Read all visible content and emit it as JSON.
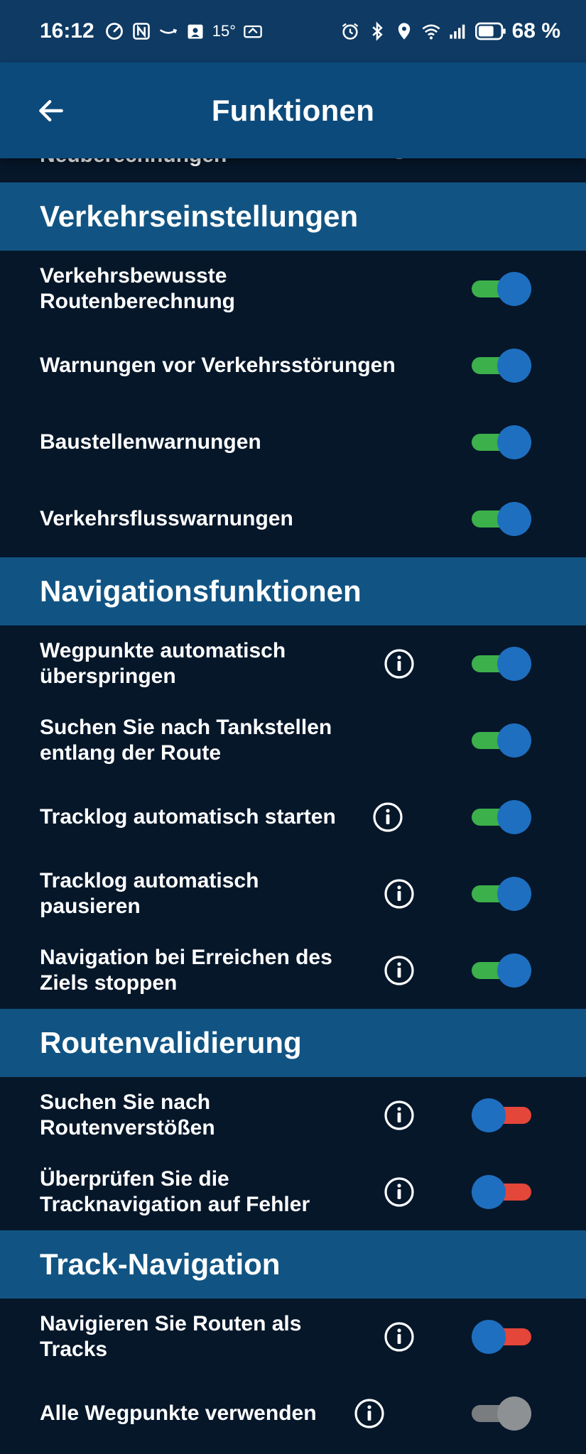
{
  "status_bar": {
    "time": "16:12",
    "temperature": "15°",
    "battery": "68 %",
    "icons_left": [
      "speedometer-icon",
      "nfc-icon",
      "amazon-icon",
      "calendar-person-icon",
      "weather-icon",
      "chat-icon"
    ],
    "icons_right": [
      "alarm-icon",
      "bluetooth-icon",
      "location-icon",
      "wifi-6-icon",
      "signal-icon",
      "battery-icon"
    ]
  },
  "header": {
    "title": "Funktionen",
    "back_icon": "arrow-left-icon"
  },
  "clipped_row": {
    "label": "Neuberechnungen"
  },
  "sections": [
    {
      "title": "Verkehrseinstellungen",
      "items": [
        {
          "label": "Verkehrsbewusste Routenberechnung",
          "info": false,
          "state": "on"
        },
        {
          "label": "Warnungen vor Verkehrsstörungen",
          "info": false,
          "state": "on"
        },
        {
          "label": "Baustellenwarnungen",
          "info": false,
          "state": "on"
        },
        {
          "label": "Verkehrsflusswarnungen",
          "info": false,
          "state": "on"
        }
      ]
    },
    {
      "title": "Navigationsfunktionen",
      "items": [
        {
          "label": "Wegpunkte automatisch überspringen",
          "info": true,
          "state": "on"
        },
        {
          "label": "Suchen Sie nach Tankstellen entlang der Route",
          "info": false,
          "state": "on"
        },
        {
          "label": "Tracklog automatisch starten",
          "info": true,
          "state": "on"
        },
        {
          "label": "Tracklog automatisch pausieren",
          "info": true,
          "state": "on"
        },
        {
          "label": "Navigation bei Erreichen des Ziels stoppen",
          "info": true,
          "state": "on"
        }
      ]
    },
    {
      "title": "Routenvalidierung",
      "items": [
        {
          "label": "Suchen Sie nach Routenverstößen",
          "info": true,
          "state": "off"
        },
        {
          "label": "Überprüfen Sie die Tracknavigation auf Fehler",
          "info": true,
          "state": "off"
        }
      ]
    },
    {
      "title": "Track-Navigation",
      "items": [
        {
          "label": "Navigieren Sie Routen als Tracks",
          "info": true,
          "state": "off"
        },
        {
          "label": "Alle Wegpunkte verwenden",
          "info": true,
          "state": "disabled"
        }
      ]
    }
  ],
  "colors": {
    "background": "#06172a",
    "status_bar": "#0e3a63",
    "header": "#0c4a7b",
    "section_header": "#115483",
    "toggle_on_track": "#3cb04a",
    "toggle_off_track": "#e4463a",
    "toggle_knob": "#1e6fc0",
    "toggle_disabled": "#7a7d80"
  }
}
